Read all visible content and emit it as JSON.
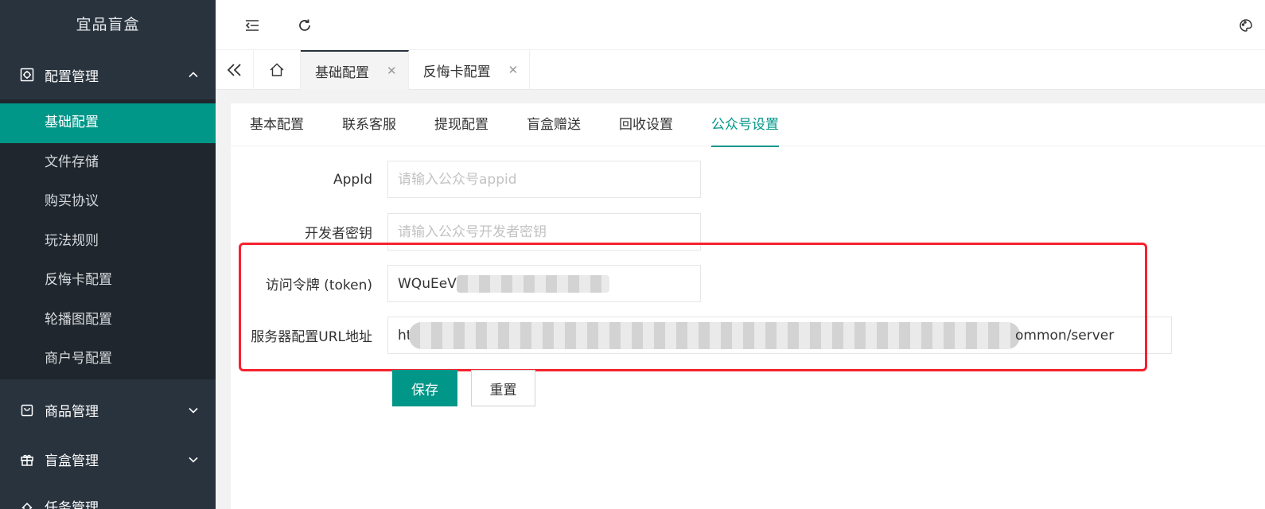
{
  "app": {
    "title": "宜品盲盒"
  },
  "colors": {
    "accent": "#009688",
    "sidebar_bg": "#28333e",
    "highlight_box": "#f5222d"
  },
  "sidebar": {
    "groups": [
      {
        "label": "配置管理",
        "icon": "settings-icon",
        "expanded": true,
        "items": [
          {
            "label": "基础配置",
            "active": true
          },
          {
            "label": "文件存储"
          },
          {
            "label": "购买协议"
          },
          {
            "label": "玩法规则"
          },
          {
            "label": "反悔卡配置"
          },
          {
            "label": "轮播图配置"
          },
          {
            "label": "商户号配置"
          }
        ]
      },
      {
        "label": "商品管理",
        "icon": "bag-icon",
        "expanded": false
      },
      {
        "label": "盲盒管理",
        "icon": "gift-icon",
        "expanded": false
      },
      {
        "label": "任务管理",
        "icon": "task-icon",
        "expanded": false
      }
    ]
  },
  "tabs": [
    {
      "label": "基础配置",
      "active": true
    },
    {
      "label": "反悔卡配置"
    }
  ],
  "content_tabs": [
    "基本配置",
    "联系客服",
    "提现配置",
    "盲盒赠送",
    "回收设置",
    "公众号设置"
  ],
  "active_content_tab": "公众号设置",
  "form": {
    "fields": [
      {
        "label": "AppId",
        "placeholder": "请输入公众号appid",
        "value": ""
      },
      {
        "label": "开发者密钥",
        "placeholder": "请输入公众号开发者密钥",
        "value": ""
      },
      {
        "label": "访问令牌 (token)",
        "placeholder": "",
        "value": "WQuEeV"
      },
      {
        "label": "服务器配置URL地址",
        "placeholder": "",
        "value": "ht",
        "value_suffix": "ommon/server"
      }
    ],
    "save_label": "保存",
    "reset_label": "重置"
  }
}
